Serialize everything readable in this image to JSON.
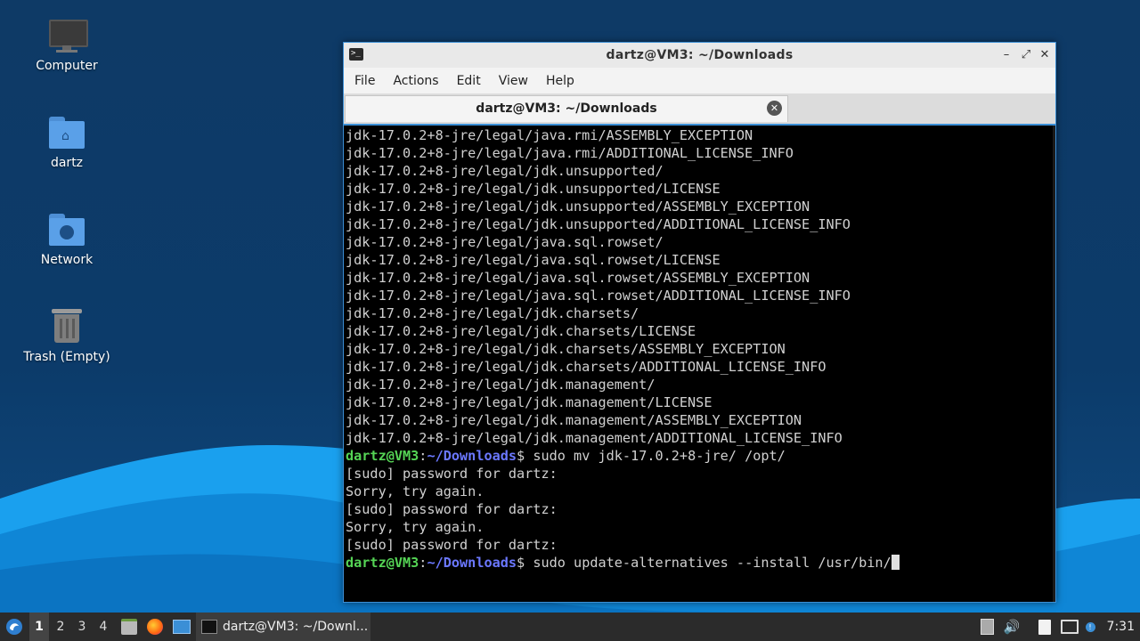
{
  "desktop": {
    "icons": [
      {
        "label": "Computer",
        "icon": "computer-icon"
      },
      {
        "label": "dartz",
        "icon": "home-folder-icon"
      },
      {
        "label": "Network",
        "icon": "network-folder-icon"
      },
      {
        "label": "Trash (Empty)",
        "icon": "trash-icon"
      }
    ]
  },
  "window": {
    "title": "dartz@VM3: ~/Downloads",
    "controls": {
      "minimize": "–",
      "maximize": "⤢",
      "close": "✕"
    },
    "menu": [
      "File",
      "Actions",
      "Edit",
      "View",
      "Help"
    ],
    "tab": {
      "label": "dartz@VM3: ~/Downloads",
      "close": "✕"
    }
  },
  "terminal": {
    "output_lines": [
      "jdk-17.0.2+8-jre/legal/java.rmi/ASSEMBLY_EXCEPTION",
      "jdk-17.0.2+8-jre/legal/java.rmi/ADDITIONAL_LICENSE_INFO",
      "jdk-17.0.2+8-jre/legal/jdk.unsupported/",
      "jdk-17.0.2+8-jre/legal/jdk.unsupported/LICENSE",
      "jdk-17.0.2+8-jre/legal/jdk.unsupported/ASSEMBLY_EXCEPTION",
      "jdk-17.0.2+8-jre/legal/jdk.unsupported/ADDITIONAL_LICENSE_INFO",
      "jdk-17.0.2+8-jre/legal/java.sql.rowset/",
      "jdk-17.0.2+8-jre/legal/java.sql.rowset/LICENSE",
      "jdk-17.0.2+8-jre/legal/java.sql.rowset/ASSEMBLY_EXCEPTION",
      "jdk-17.0.2+8-jre/legal/java.sql.rowset/ADDITIONAL_LICENSE_INFO",
      "jdk-17.0.2+8-jre/legal/jdk.charsets/",
      "jdk-17.0.2+8-jre/legal/jdk.charsets/LICENSE",
      "jdk-17.0.2+8-jre/legal/jdk.charsets/ASSEMBLY_EXCEPTION",
      "jdk-17.0.2+8-jre/legal/jdk.charsets/ADDITIONAL_LICENSE_INFO",
      "jdk-17.0.2+8-jre/legal/jdk.management/",
      "jdk-17.0.2+8-jre/legal/jdk.management/LICENSE",
      "jdk-17.0.2+8-jre/legal/jdk.management/ASSEMBLY_EXCEPTION",
      "jdk-17.0.2+8-jre/legal/jdk.management/ADDITIONAL_LICENSE_INFO"
    ],
    "prompt_user": "dartz@VM3",
    "prompt_sep": ":",
    "prompt_path": "~/Downloads",
    "prompt_end": "$ ",
    "command1": "sudo mv jdk-17.0.2+8-jre/ /opt/",
    "after_lines": [
      "[sudo] password for dartz:",
      "Sorry, try again.",
      "[sudo] password for dartz:",
      "Sorry, try again.",
      "[sudo] password for dartz:"
    ],
    "command2": "sudo update-alternatives --install /usr/bin/"
  },
  "taskbar": {
    "workspaces": [
      "1",
      "2",
      "3",
      "4"
    ],
    "active_workspace": "1",
    "launchers": [
      "file-manager-icon",
      "firefox-icon",
      "desktop-icon"
    ],
    "task_label": "dartz@VM3: ~/Downl...",
    "clock": "7:31",
    "tray": [
      "clipboard-icon",
      "volume-icon",
      "notes-icon",
      "display-icon",
      "updates-icon"
    ]
  },
  "colors": {
    "desktop_bg": "#0e3a66",
    "wave_light": "#1e9be8",
    "window_border": "#3b8fd6",
    "prompt_user": "#55d455",
    "prompt_path": "#6b78ff"
  }
}
